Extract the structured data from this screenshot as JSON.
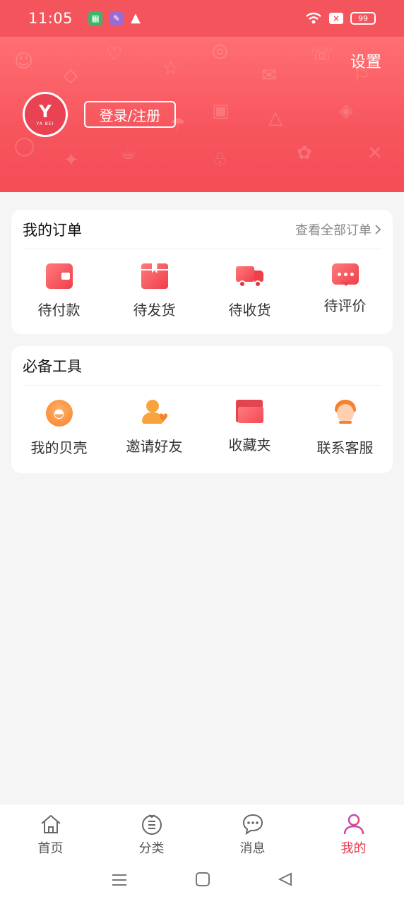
{
  "status_bar": {
    "time": "11:05",
    "battery": "99",
    "warn_glyph": "▲"
  },
  "header": {
    "settings_label": "设置",
    "avatar_brand": "YA BEI",
    "avatar_letter": "Y",
    "login_label": "登录/注册"
  },
  "orders": {
    "title": "我的订单",
    "view_all": "查看全部订单",
    "items": [
      {
        "label": "待付款",
        "icon": "wallet-icon"
      },
      {
        "label": "待发货",
        "icon": "package-icon"
      },
      {
        "label": "待收货",
        "icon": "truck-icon"
      },
      {
        "label": "待评价",
        "icon": "comment-icon"
      }
    ]
  },
  "tools": {
    "title": "必备工具",
    "items": [
      {
        "label": "我的贝壳",
        "icon": "shell-icon"
      },
      {
        "label": "邀请好友",
        "icon": "invite-friend-icon"
      },
      {
        "label": "收藏夹",
        "icon": "folder-icon"
      },
      {
        "label": "联系客服",
        "icon": "customer-service-icon"
      }
    ]
  },
  "bottom_nav": [
    {
      "label": "首页",
      "icon": "home-icon"
    },
    {
      "label": "分类",
      "icon": "category-icon"
    },
    {
      "label": "消息",
      "icon": "message-icon"
    },
    {
      "label": "我的",
      "icon": "profile-icon",
      "active": true
    }
  ],
  "colors": {
    "brand": "#f4545b",
    "active_nav": "#e83a4f",
    "accent_orange": "#f7812c"
  }
}
